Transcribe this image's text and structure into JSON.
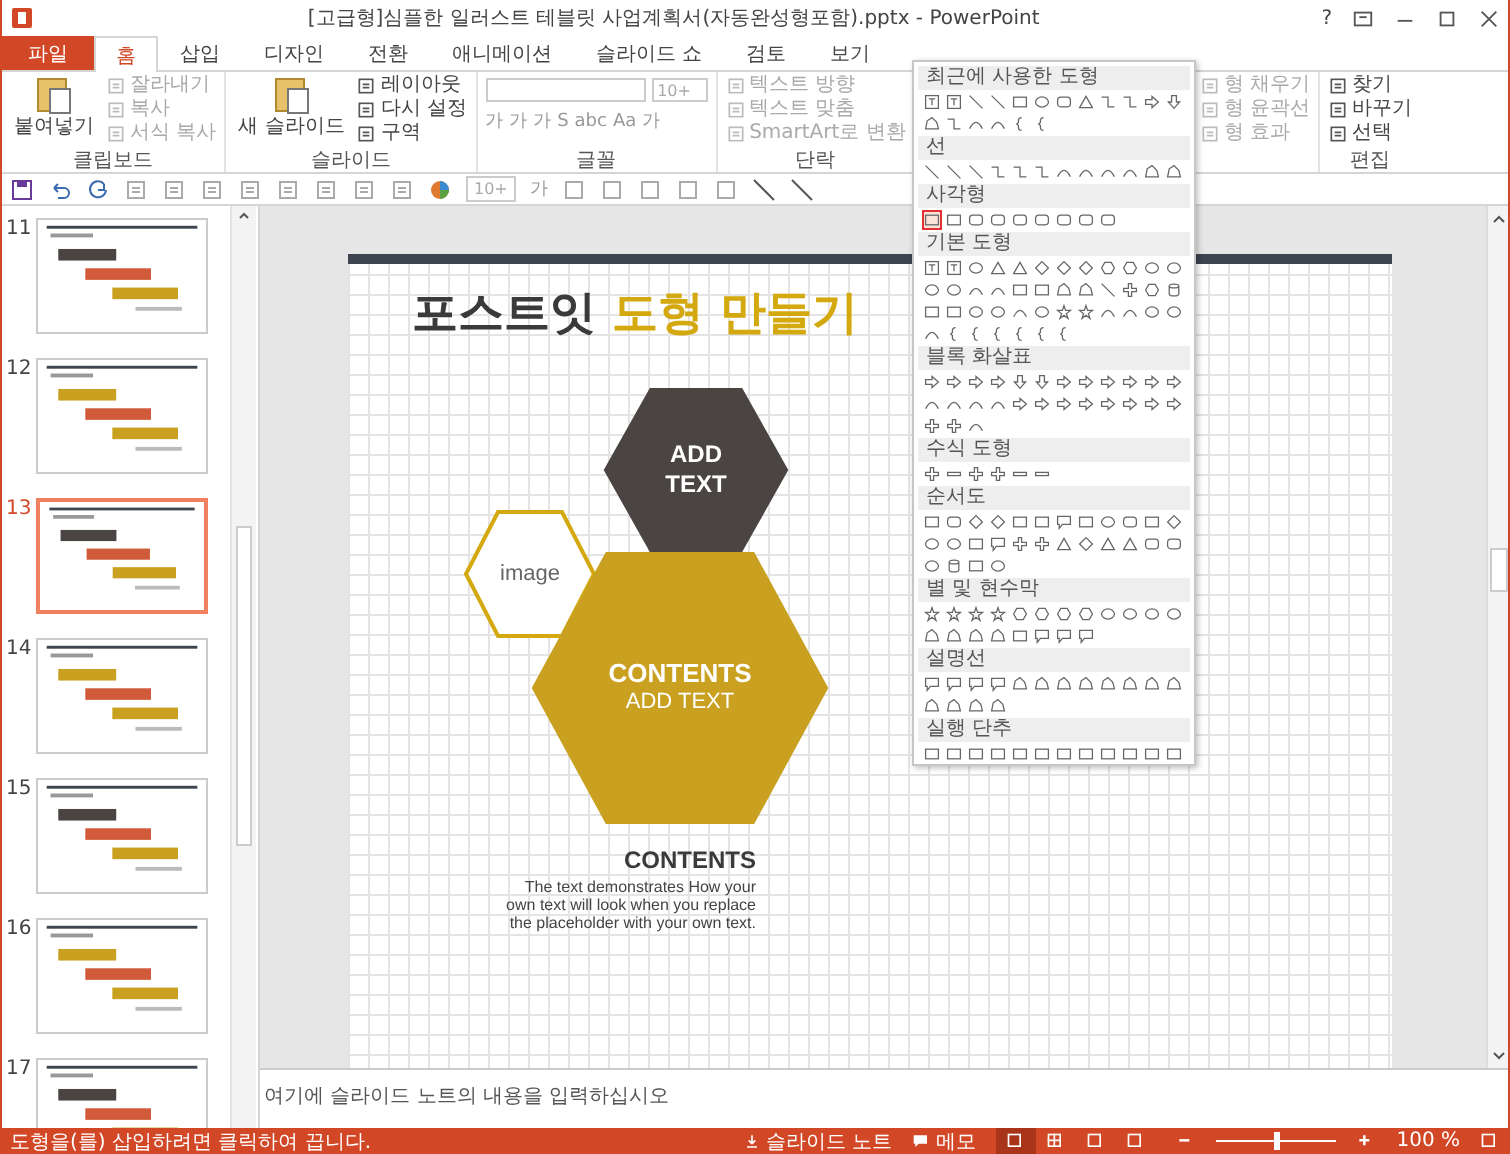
{
  "window": {
    "title": "[고급형]심플한 일러스트 테블릿 사업계획서(자동완성형포함).pptx - PowerPoint",
    "help": "?"
  },
  "tabs": [
    {
      "label": "파일",
      "kind": "file",
      "selected": false
    },
    {
      "label": "홈",
      "kind": "tab",
      "selected": true
    },
    {
      "label": "삽입",
      "kind": "tab",
      "selected": false
    },
    {
      "label": "디자인",
      "kind": "tab",
      "selected": false
    },
    {
      "label": "전환",
      "kind": "tab",
      "selected": false
    },
    {
      "label": "애니메이션",
      "kind": "tab",
      "selected": false
    },
    {
      "label": "슬라이드 쇼",
      "kind": "tab",
      "selected": false
    },
    {
      "label": "검토",
      "kind": "tab",
      "selected": false
    },
    {
      "label": "보기",
      "kind": "tab",
      "selected": false
    }
  ],
  "ribbon": {
    "groups": [
      {
        "label": "클립보드",
        "large": "붙여넣기",
        "items": [
          {
            "label": "잘라내기",
            "disabled": true
          },
          {
            "label": "복사",
            "disabled": true
          },
          {
            "label": "서식 복사",
            "disabled": true
          }
        ]
      },
      {
        "label": "슬라이드",
        "large": "새 슬라이드",
        "items": [
          {
            "label": "레이아웃",
            "disabled": false
          },
          {
            "label": "다시 설정",
            "disabled": false
          },
          {
            "label": "구역",
            "disabled": false
          }
        ]
      },
      {
        "label": "글꼴",
        "size": "10+",
        "glyphs": [
          "가",
          "가",
          "가",
          "S",
          "abc",
          "Aa",
          "가"
        ]
      },
      {
        "label": "단락",
        "items": [
          {
            "label": "텍스트 방향",
            "disabled": true
          },
          {
            "label": "텍스트 맞춤",
            "disabled": true
          },
          {
            "label": "SmartArt로 변환",
            "disabled": true
          }
        ]
      },
      {
        "items": [
          {
            "label": "형 채우기",
            "disabled": true
          },
          {
            "label": "형 윤곽선",
            "disabled": true
          },
          {
            "label": "형 효과",
            "disabled": true
          }
        ]
      },
      {
        "label": "편집",
        "items": [
          {
            "label": "찾기",
            "disabled": false
          },
          {
            "label": "바꾸기",
            "disabled": false
          },
          {
            "label": "선택",
            "disabled": false
          }
        ]
      }
    ]
  },
  "quick_access": {
    "size": "10+",
    "glyph": "가"
  },
  "slides": [
    {
      "number": "11",
      "selected": false
    },
    {
      "number": "12",
      "selected": false
    },
    {
      "number": "13",
      "selected": true
    },
    {
      "number": "14",
      "selected": false
    },
    {
      "number": "15",
      "selected": false
    },
    {
      "number": "16",
      "selected": false
    },
    {
      "number": "17",
      "selected": false
    }
  ],
  "slide": {
    "title": "포스트잇",
    "title_highlight": "도형 만들기",
    "hexagons": [
      {
        "kind": "dark",
        "lines": [
          "ADD",
          "TEXT"
        ]
      },
      {
        "kind": "outline",
        "lines": [
          "image"
        ]
      },
      {
        "kind": "gold",
        "lines": [
          "CONTENTS",
          "ADD TEXT"
        ]
      }
    ],
    "caption": {
      "heading": "CONTENTS",
      "body": "The text demonstrates How your own text will look when you replace the placeholder with your own text."
    }
  },
  "gallery": {
    "sections": [
      {
        "title": "최근에 사용한 도형",
        "selected": false
      },
      {
        "title": "선",
        "selected": false
      },
      {
        "title": "사각형",
        "selected": true
      },
      {
        "title": "기본 도형",
        "selected": false
      },
      {
        "title": "블록 화살표",
        "selected": false
      },
      {
        "title": "수식 도형",
        "selected": false
      },
      {
        "title": "순서도",
        "selected": false
      },
      {
        "title": "별 및 현수막",
        "selected": false
      },
      {
        "title": "설명선",
        "selected": false
      },
      {
        "title": "실행 단추",
        "selected": false
      }
    ]
  },
  "notes": {
    "placeholder": "여기에 슬라이드 노트의 내용을 입력하십시오"
  },
  "status": {
    "message": "도형을(를) 삽입하려면 클릭하여 끕니다.",
    "notes": "슬라이드 노트",
    "comments": "메모",
    "views": [
      {
        "selected": true
      },
      {
        "selected": false
      },
      {
        "selected": false
      },
      {
        "selected": false
      }
    ],
    "zoom_slider": {
      "level": 0.5
    },
    "zoom": "100 %"
  }
}
